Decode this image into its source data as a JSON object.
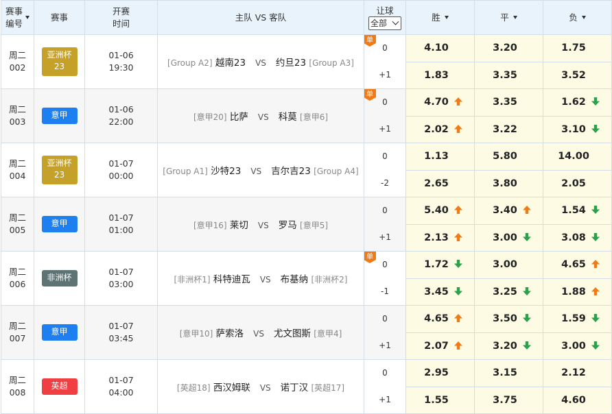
{
  "header": {
    "col_no": [
      "赛事",
      "编号"
    ],
    "col_league": "赛事",
    "col_time": [
      "开赛",
      "时间"
    ],
    "col_match": "主队 VS 客队",
    "col_handicap": "让球",
    "handicap_select": "全部",
    "col_win": "胜",
    "col_draw": "平",
    "col_lose": "负"
  },
  "vs_text": "VS",
  "dan_label": "单",
  "colors": {
    "up": "#f07a15",
    "down": "#2aa14a",
    "asia": "#c6a12a",
    "seria": "#1e80f0",
    "africa": "#5e7373",
    "epl": "#ef3f43"
  },
  "matches": [
    {
      "no": [
        "周二",
        "002"
      ],
      "league": [
        "亚洲杯",
        "23"
      ],
      "league_type": "asia",
      "time": [
        "01-06",
        "19:30"
      ],
      "home_rank": "[Group A2]",
      "home": "越南23",
      "away": "约旦23",
      "away_rank": "[Group A3]",
      "dan": true,
      "rows": [
        {
          "hcap": "0",
          "win": "4.10",
          "win_dir": "",
          "draw": "3.20",
          "draw_dir": "",
          "lose": "1.75",
          "lose_dir": ""
        },
        {
          "hcap": "+1",
          "win": "1.83",
          "win_dir": "",
          "draw": "3.35",
          "draw_dir": "",
          "lose": "3.52",
          "lose_dir": ""
        }
      ]
    },
    {
      "no": [
        "周二",
        "003"
      ],
      "league": [
        "意甲"
      ],
      "league_type": "seria",
      "time": [
        "01-06",
        "22:00"
      ],
      "home_rank": "[意甲20]",
      "home": "比萨",
      "away": "科莫",
      "away_rank": "[意甲6]",
      "dan": true,
      "rows": [
        {
          "hcap": "0",
          "win": "4.70",
          "win_dir": "up",
          "draw": "3.35",
          "draw_dir": "",
          "lose": "1.62",
          "lose_dir": "down"
        },
        {
          "hcap": "+1",
          "win": "2.02",
          "win_dir": "up",
          "draw": "3.22",
          "draw_dir": "",
          "lose": "3.10",
          "lose_dir": "down"
        }
      ]
    },
    {
      "no": [
        "周二",
        "004"
      ],
      "league": [
        "亚洲杯",
        "23"
      ],
      "league_type": "asia",
      "time": [
        "01-07",
        "00:00"
      ],
      "home_rank": "[Group A1]",
      "home": "沙特23",
      "away": "吉尔吉23",
      "away_rank": "[Group A4]",
      "dan": false,
      "rows": [
        {
          "hcap": "0",
          "win": "1.13",
          "win_dir": "",
          "draw": "5.80",
          "draw_dir": "",
          "lose": "14.00",
          "lose_dir": ""
        },
        {
          "hcap": "-2",
          "win": "2.65",
          "win_dir": "",
          "draw": "3.80",
          "draw_dir": "",
          "lose": "2.05",
          "lose_dir": ""
        }
      ]
    },
    {
      "no": [
        "周二",
        "005"
      ],
      "league": [
        "意甲"
      ],
      "league_type": "seria",
      "time": [
        "01-07",
        "01:00"
      ],
      "home_rank": "[意甲16]",
      "home": "莱切",
      "away": "罗马",
      "away_rank": "[意甲5]",
      "dan": false,
      "rows": [
        {
          "hcap": "0",
          "win": "5.40",
          "win_dir": "up",
          "draw": "3.40",
          "draw_dir": "up",
          "lose": "1.54",
          "lose_dir": "down"
        },
        {
          "hcap": "+1",
          "win": "2.13",
          "win_dir": "up",
          "draw": "3.00",
          "draw_dir": "down",
          "lose": "3.08",
          "lose_dir": "down"
        }
      ]
    },
    {
      "no": [
        "周二",
        "006"
      ],
      "league": [
        "非洲杯"
      ],
      "league_type": "africa",
      "time": [
        "01-07",
        "03:00"
      ],
      "home_rank": "[非洲杯1]",
      "home": "科特迪瓦",
      "away": "布基纳",
      "away_rank": "[非洲杯2]",
      "dan": true,
      "rows": [
        {
          "hcap": "0",
          "win": "1.72",
          "win_dir": "down",
          "draw": "3.00",
          "draw_dir": "",
          "lose": "4.65",
          "lose_dir": "up"
        },
        {
          "hcap": "-1",
          "win": "3.45",
          "win_dir": "down",
          "draw": "3.25",
          "draw_dir": "down",
          "lose": "1.88",
          "lose_dir": "up"
        }
      ]
    },
    {
      "no": [
        "周二",
        "007"
      ],
      "league": [
        "意甲"
      ],
      "league_type": "seria",
      "time": [
        "01-07",
        "03:45"
      ],
      "home_rank": "[意甲10]",
      "home": "萨索洛",
      "away": "尤文图斯",
      "away_rank": "[意甲4]",
      "dan": false,
      "rows": [
        {
          "hcap": "0",
          "win": "4.65",
          "win_dir": "up",
          "draw": "3.50",
          "draw_dir": "down",
          "lose": "1.59",
          "lose_dir": "down"
        },
        {
          "hcap": "+1",
          "win": "2.07",
          "win_dir": "up",
          "draw": "3.20",
          "draw_dir": "down",
          "lose": "3.00",
          "lose_dir": "down"
        }
      ]
    },
    {
      "no": [
        "周二",
        "008"
      ],
      "league": [
        "英超"
      ],
      "league_type": "epl",
      "time": [
        "01-07",
        "04:00"
      ],
      "home_rank": "[英超18]",
      "home": "西汉姆联",
      "away": "诺丁汉",
      "away_rank": "[英超17]",
      "dan": false,
      "rows": [
        {
          "hcap": "0",
          "win": "2.95",
          "win_dir": "",
          "draw": "3.15",
          "draw_dir": "",
          "lose": "2.12",
          "lose_dir": ""
        },
        {
          "hcap": "+1",
          "win": "1.55",
          "win_dir": "",
          "draw": "3.75",
          "draw_dir": "",
          "lose": "4.60",
          "lose_dir": ""
        }
      ]
    }
  ]
}
